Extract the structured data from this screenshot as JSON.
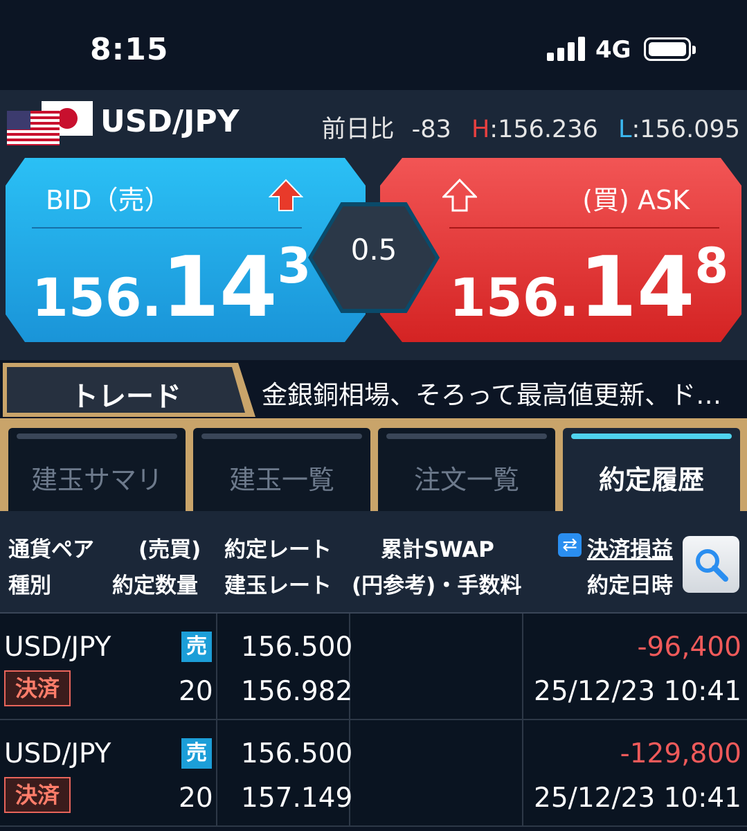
{
  "status_bar": {
    "time": "8:15",
    "network": "4G"
  },
  "pair": {
    "name": "USD/JPY",
    "change_label": "前日比",
    "change_value": "-83",
    "high_label": "H",
    "high_value": "156.236",
    "low_label": "L",
    "low_value": "156.095"
  },
  "bid": {
    "label": "BID（売）",
    "price_head": "156.",
    "price_big": "14",
    "price_small": "3",
    "color": "#1a94d8"
  },
  "ask": {
    "label": "(買) ASK",
    "price_head": "156.",
    "price_big": "14",
    "price_small": "8",
    "color": "#d42323"
  },
  "spread": "0.5",
  "trade_tab": "トレード",
  "news_ticker": "金銀銅相場、そろって最高値更新、ド…",
  "tabs": [
    {
      "label": "建玉サマリ",
      "active": false
    },
    {
      "label": "建玉一覧",
      "active": false
    },
    {
      "label": "注文一覧",
      "active": false
    },
    {
      "label": "約定履歴",
      "active": true
    }
  ],
  "table_header": {
    "col1_top": "通貨ペア",
    "col1_bottom": "種別",
    "col2_top": "(売買)",
    "col2_bottom": "約定数量",
    "col3_top": "約定レート",
    "col3_bottom": "建玉レート",
    "col4_top": "累計SWAP",
    "col4_bottom": "(円参考)・手数料",
    "col5_top": "決済損益",
    "col5_bottom": "約定日時"
  },
  "rows": [
    {
      "pair": "USD/JPY",
      "side": "売",
      "type": "決済",
      "quantity": "20",
      "exec_rate": "156.500",
      "position_rate": "156.982",
      "pnl": "-96,400",
      "datetime": "25/12/23 10:41"
    },
    {
      "pair": "USD/JPY",
      "side": "売",
      "type": "決済",
      "quantity": "20",
      "exec_rate": "156.500",
      "position_rate": "157.149",
      "pnl": "-129,800",
      "datetime": "25/12/23 10:41"
    }
  ]
}
